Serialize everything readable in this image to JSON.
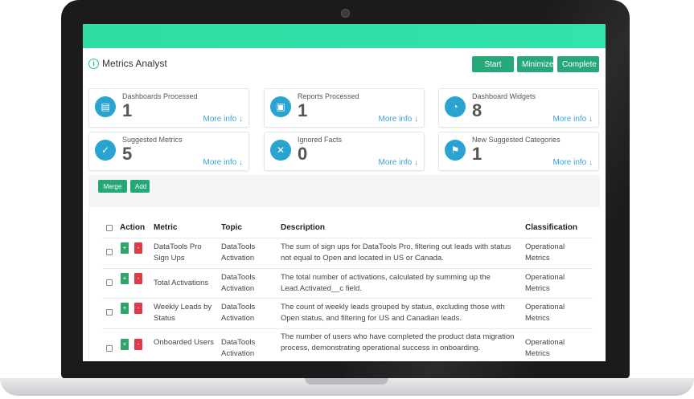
{
  "app": {
    "title": "Metrics Analyst"
  },
  "toolbar": {
    "start_over": "Start Over",
    "minimize": "Minimize",
    "complete": "Complete"
  },
  "stats": [
    {
      "label": "Dashboards Processed",
      "value": "1",
      "more": "More info ↓",
      "icon": "dashboard-doc-icon"
    },
    {
      "label": "Reports Processed",
      "value": "1",
      "more": "More info ↓",
      "icon": "report-icon"
    },
    {
      "label": "Dashboard Widgets",
      "value": "8",
      "more": "More info ↓",
      "icon": "gauge-icon"
    },
    {
      "label": "Suggested Metrics",
      "value": "5",
      "more": "More info ↓",
      "icon": "check-circle-icon"
    },
    {
      "label": "Ignored Facts",
      "value": "0",
      "more": "More info ↓",
      "icon": "x-circle-icon"
    },
    {
      "label": "New Suggested Categories",
      "value": "1",
      "more": "More info ↓",
      "icon": "flag-icon"
    }
  ],
  "actions": {
    "merge": "Merge",
    "add": "Add"
  },
  "table": {
    "headers": {
      "action": "Action",
      "metric": "Metric",
      "topic": "Topic",
      "description": "Description",
      "classification": "Classification"
    },
    "rows": [
      {
        "metric": "DataTools Pro Sign Ups",
        "topic": "DataTools Activation",
        "description": "The sum of sign ups for DataTools Pro, filtering out leads with status not equal to Open and located in US or Canada.",
        "classification": "Operational Metrics"
      },
      {
        "metric": "Total Activations",
        "topic": "DataTools Activation",
        "description": "The total number of activations, calculated by summing up the Lead.Activated__c field.",
        "classification": "Operational Metrics"
      },
      {
        "metric": "Weekly Leads by Status",
        "topic": "DataTools Activation",
        "description": "The count of weekly leads grouped by status, excluding those with Open status, and filtering for US and Canadian leads.",
        "classification": "Operational Metrics"
      },
      {
        "metric": "Onboarded Users",
        "topic": "DataTools Activation",
        "description": "The number of users who have completed the product data migration process, demonstrating operational success in onboarding.",
        "classification": "Operational Metrics"
      }
    ]
  },
  "colors": {
    "accent": "#2fdca3",
    "button": "#26a878",
    "icon_bg": "#2aa3d1",
    "link": "#3aa3d8",
    "danger": "#e03b4b"
  }
}
